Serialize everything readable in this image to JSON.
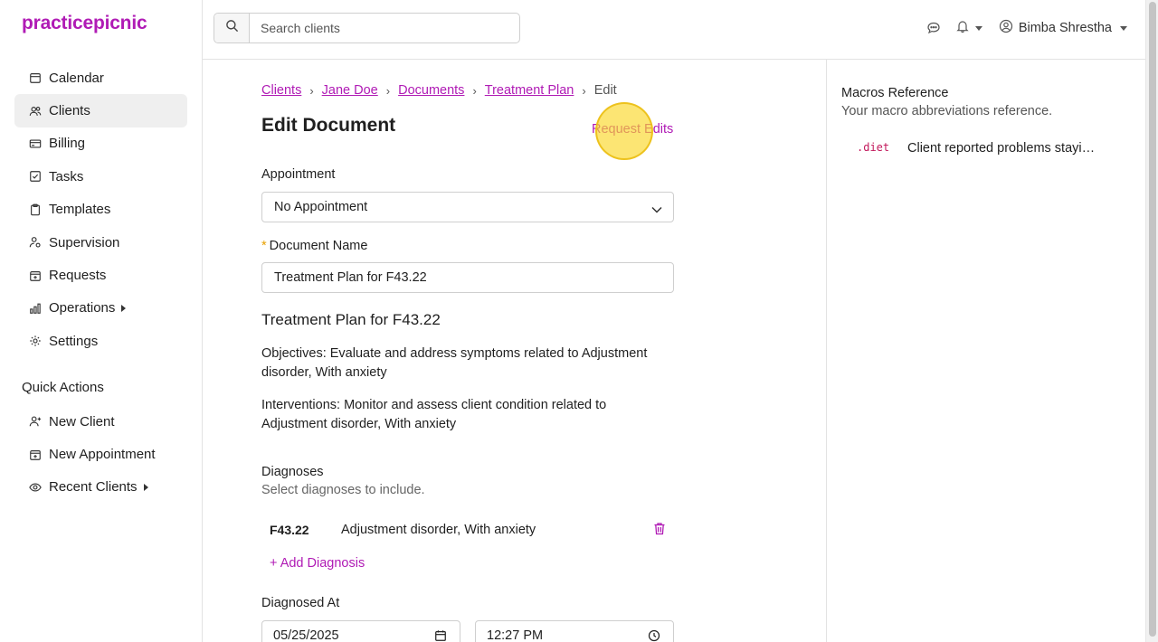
{
  "brand": {
    "logo": "practicepicnic",
    "accent": "#b01bb5"
  },
  "sidebar": {
    "items": [
      {
        "label": "Calendar",
        "icon": "calendar-icon"
      },
      {
        "label": "Clients",
        "icon": "users-icon",
        "active": true
      },
      {
        "label": "Billing",
        "icon": "credit-card-icon"
      },
      {
        "label": "Tasks",
        "icon": "checkbox-icon"
      },
      {
        "label": "Templates",
        "icon": "clipboard-icon"
      },
      {
        "label": "Supervision",
        "icon": "person-gear-icon"
      },
      {
        "label": "Requests",
        "icon": "calendar-plus-icon"
      },
      {
        "label": "Operations",
        "icon": "bar-chart-icon",
        "expandable": true
      },
      {
        "label": "Settings",
        "icon": "gear-icon"
      }
    ],
    "quick_actions_title": "Quick Actions",
    "quick_actions": [
      {
        "label": "New Client",
        "icon": "person-plus-icon"
      },
      {
        "label": "New Appointment",
        "icon": "calendar-plus-icon"
      },
      {
        "label": "Recent Clients",
        "icon": "eye-icon",
        "expandable": true
      }
    ]
  },
  "header": {
    "search_placeholder": "Search clients",
    "user_name": "Bimba Shrestha"
  },
  "breadcrumb": {
    "links": [
      "Clients",
      "Jane Doe",
      "Documents",
      "Treatment Plan"
    ],
    "current": "Edit"
  },
  "page": {
    "title": "Edit Document",
    "request_edits": "Request Edits"
  },
  "form": {
    "appointment_label": "Appointment",
    "appointment_value": "No Appointment",
    "document_name_label": "Document Name",
    "document_name_value": "Treatment Plan for F43.22",
    "doc_heading": "Treatment Plan for F43.22",
    "objectives": "Objectives: Evaluate and address symptoms related to Adjustment disorder, With anxiety",
    "interventions": "Interventions: Monitor and assess client condition related to Adjustment disorder, With anxiety",
    "diagnoses_label": "Diagnoses",
    "diagnoses_sub": "Select diagnoses to include.",
    "diagnoses": [
      {
        "code": "F43.22",
        "description": "Adjustment disorder, With anxiety"
      }
    ],
    "add_diagnosis": "+ Add Diagnosis",
    "diagnosed_at_label": "Diagnosed At",
    "diagnosed_date": "05/25/2025",
    "diagnosed_time": "12:27 PM"
  },
  "macros": {
    "title": "Macros Reference",
    "subtitle": "Your macro abbreviations reference.",
    "items": [
      {
        "key": ".diet",
        "text": "Client reported problems stayi…"
      }
    ]
  }
}
